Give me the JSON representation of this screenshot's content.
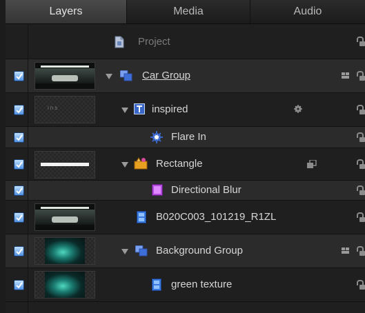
{
  "tabs": [
    {
      "label": "Layers",
      "active": true
    },
    {
      "label": "Media",
      "active": false
    },
    {
      "label": "Audio",
      "active": false
    }
  ],
  "project": {
    "label": "Project"
  },
  "layers": [
    {
      "name": "Car Group",
      "kind": "group",
      "checked": true,
      "expanded": true,
      "thumb": "car",
      "icon": "group-icon"
    },
    {
      "name": "inspired",
      "kind": "text",
      "checked": true,
      "expanded": true,
      "thumb": "text",
      "thumb_text": "ins",
      "icon": "text-layer-icon"
    },
    {
      "name": "Flare In",
      "kind": "behavior",
      "checked": true,
      "icon": "behavior-gear-icon"
    },
    {
      "name": "Rectangle",
      "kind": "shape",
      "checked": true,
      "expanded": true,
      "thumb": "rect",
      "icon": "shape-icon"
    },
    {
      "name": "Directional Blur",
      "kind": "filter",
      "checked": true,
      "icon": "filter-icon"
    },
    {
      "name": "B020C003_101219_R1ZL",
      "kind": "clip",
      "checked": true,
      "thumb": "car",
      "icon": "clip-icon"
    },
    {
      "name": "Background Group",
      "kind": "group",
      "checked": true,
      "expanded": true,
      "thumb": "green",
      "icon": "group-icon"
    },
    {
      "name": "green texture",
      "kind": "clip",
      "checked": true,
      "thumb": "green",
      "icon": "clip-icon"
    }
  ],
  "colors": {
    "accent": "#4f8fe0",
    "group": "#3e6fd8",
    "filter": "#b04ad8",
    "shape": "#e8a020"
  }
}
